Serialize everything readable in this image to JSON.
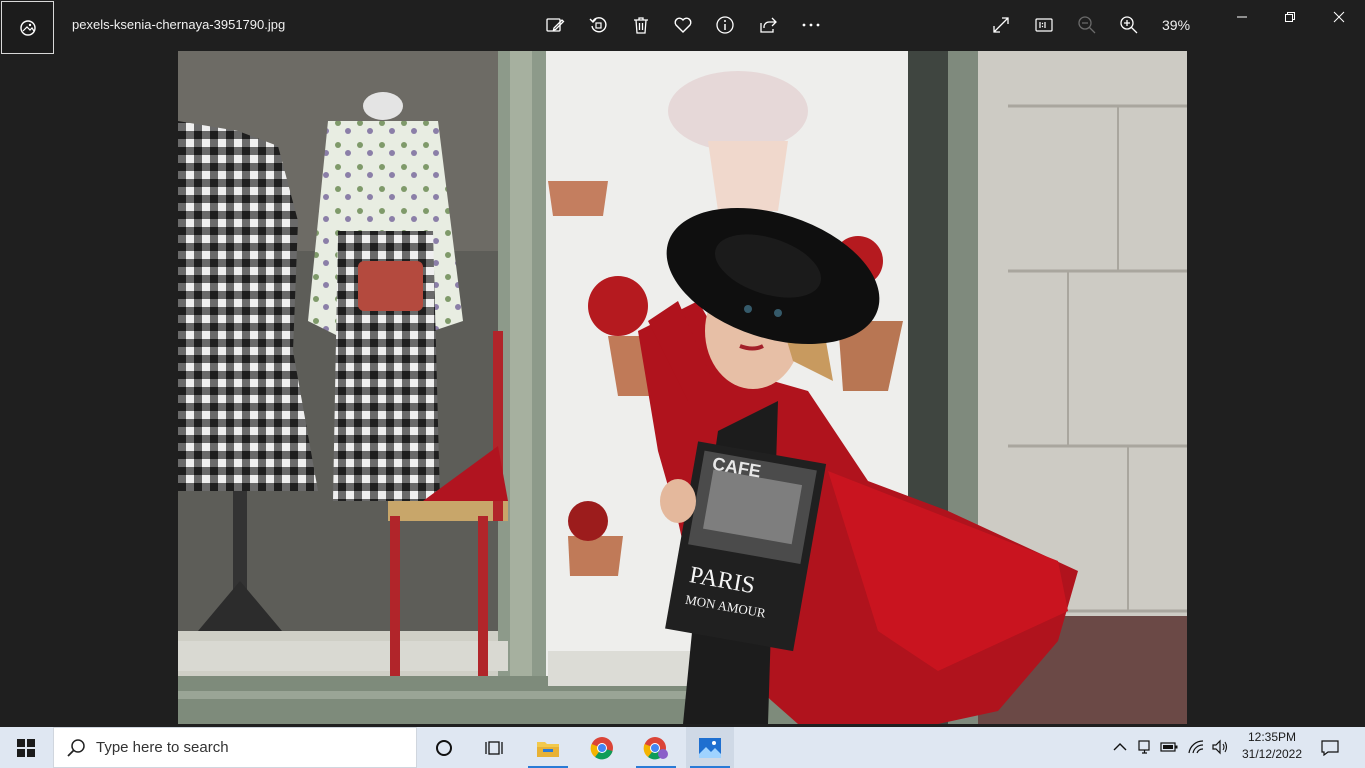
{
  "window": {
    "file_name": "pexels-ksenia-chernaya-3951790.jpg",
    "zoom_level": "39%"
  },
  "toolbar": {
    "icons": [
      "edit-image-icon",
      "rotate-icon",
      "delete-icon",
      "favorite-icon",
      "info-icon",
      "share-icon",
      "more-icon"
    ],
    "view_icons": [
      "fullscreen-icon",
      "actual-size-icon",
      "zoom-out-icon",
      "zoom-in-icon"
    ]
  },
  "photo": {
    "book_title_line1": "PARIS",
    "book_title_line2": "MON AMOUR",
    "book_cover_sign": "CAFE"
  },
  "taskbar": {
    "search_placeholder": "Type here to search",
    "time": "12:35PM",
    "date": "31/12/2022",
    "accent": "#2a7bd6"
  }
}
